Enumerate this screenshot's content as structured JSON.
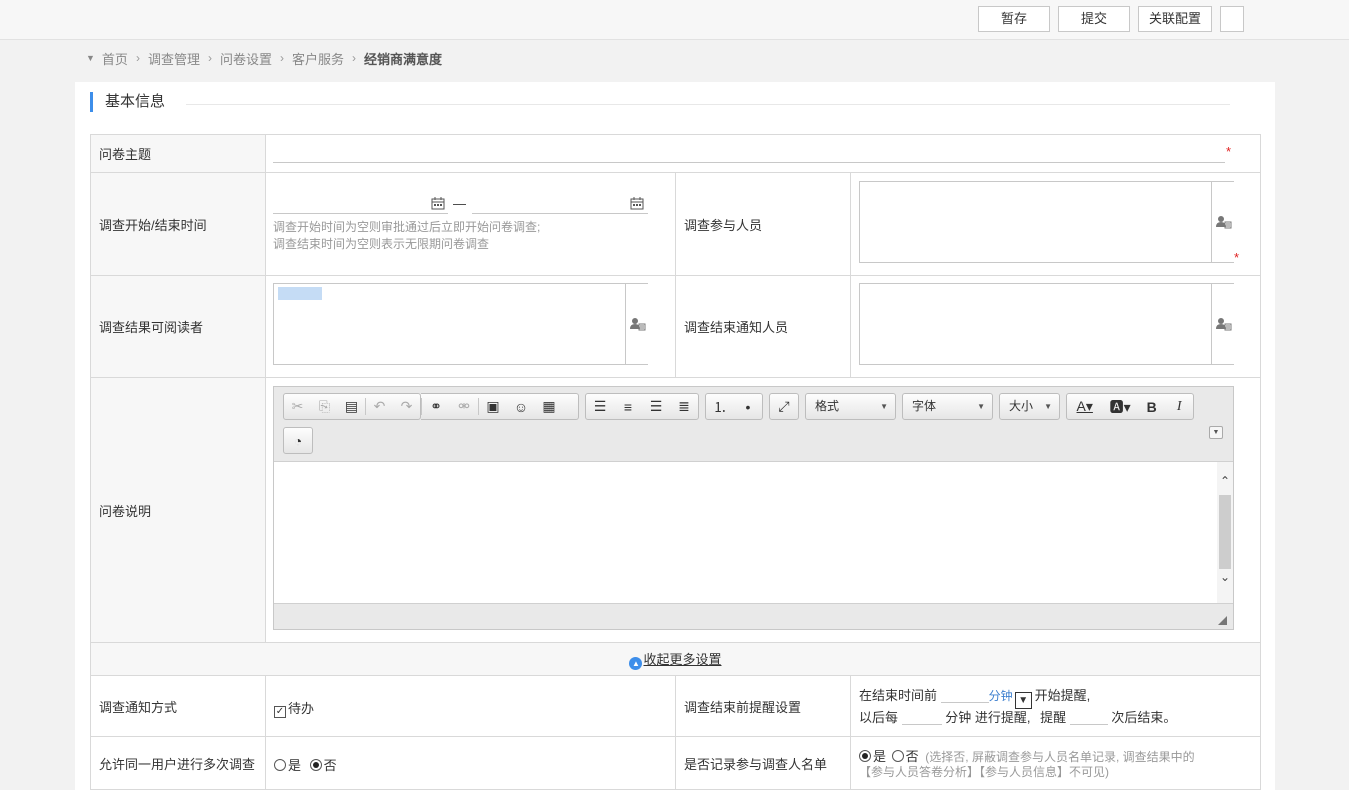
{
  "toolbar": {
    "save_draft": "暂存",
    "submit": "提交",
    "link_config": "关联配置"
  },
  "breadcrumb": {
    "items": [
      "首页",
      "调查管理",
      "问卷设置",
      "客户服务"
    ],
    "current": "经销商满意度"
  },
  "section": {
    "title": "基本信息"
  },
  "form": {
    "subject_label": "问卷主题",
    "subject_value": "",
    "time_label": "调查开始/结束时间",
    "time_dash": "—",
    "time_hint_1": "调查开始时间为空则审批通过后立即开始问卷调查;",
    "time_hint_2": "调查结束时间为空则表示无限期问卷调查",
    "participants_label": "调查参与人员",
    "readers_label": "调查结果可阅读者",
    "notify_label": "调查结束通知人员",
    "desc_label": "问卷说明",
    "required_mark": "*"
  },
  "editor": {
    "format_label": "格式",
    "font_label": "字体",
    "size_label": "大小"
  },
  "more": {
    "toggle_label": "收起更多设置"
  },
  "settings": {
    "notify_method_label": "调查通知方式",
    "notify_todo": "待办",
    "reminder_label": "调查结束前提醒设置",
    "reminder_pre": "在结束时间前",
    "reminder_unit": "分钟",
    "reminder_start": "开始提醒,",
    "reminder_every": "以后每",
    "reminder_every_unit": "分钟 进行提醒,",
    "reminder_times": "提醒",
    "reminder_end": "次后结束。",
    "multi_label": "允许同一用户进行多次调查",
    "yes": "是",
    "no": "否",
    "record_label": "是否记录参与调查人名单",
    "record_hint_1": "(选择否, 屏蔽调查参与人员名单记录, 调查结果中的",
    "record_hint_2": "【参与人员答卷分析】【参与人员信息】不可见)"
  }
}
